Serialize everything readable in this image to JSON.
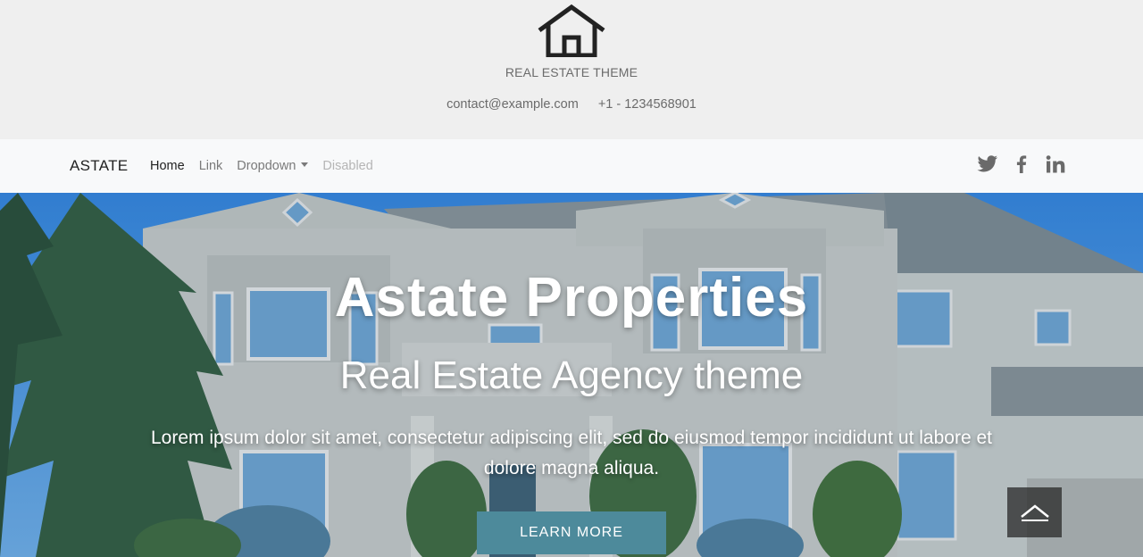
{
  "header": {
    "brand_title": "REAL ESTATE THEME",
    "email": "contact@example.com",
    "phone": "+1 - 1234568901",
    "logo_icon": "house-icon"
  },
  "navbar": {
    "brand": "ASTATE",
    "links": [
      {
        "label": "Home",
        "state": "active"
      },
      {
        "label": "Link",
        "state": "normal"
      },
      {
        "label": "Dropdown",
        "state": "dropdown"
      },
      {
        "label": "Disabled",
        "state": "disabled"
      }
    ],
    "social_icons": [
      "twitter-icon",
      "facebook-icon",
      "linkedin-icon"
    ]
  },
  "hero": {
    "title": "Astate Properties",
    "subtitle": "Real Estate Agency theme",
    "text": "Lorem ipsum dolor sit amet, consectetur adipiscing elit, sed do eiusmod tempor incididunt ut labore et dolore magna aliqua.",
    "button_label": "LEARN MORE"
  },
  "colors": {
    "header_bg": "#efefef",
    "navbar_bg": "#f8f9fa",
    "button_bg": "#4d8a9b",
    "sky": "#3f8fe0"
  }
}
